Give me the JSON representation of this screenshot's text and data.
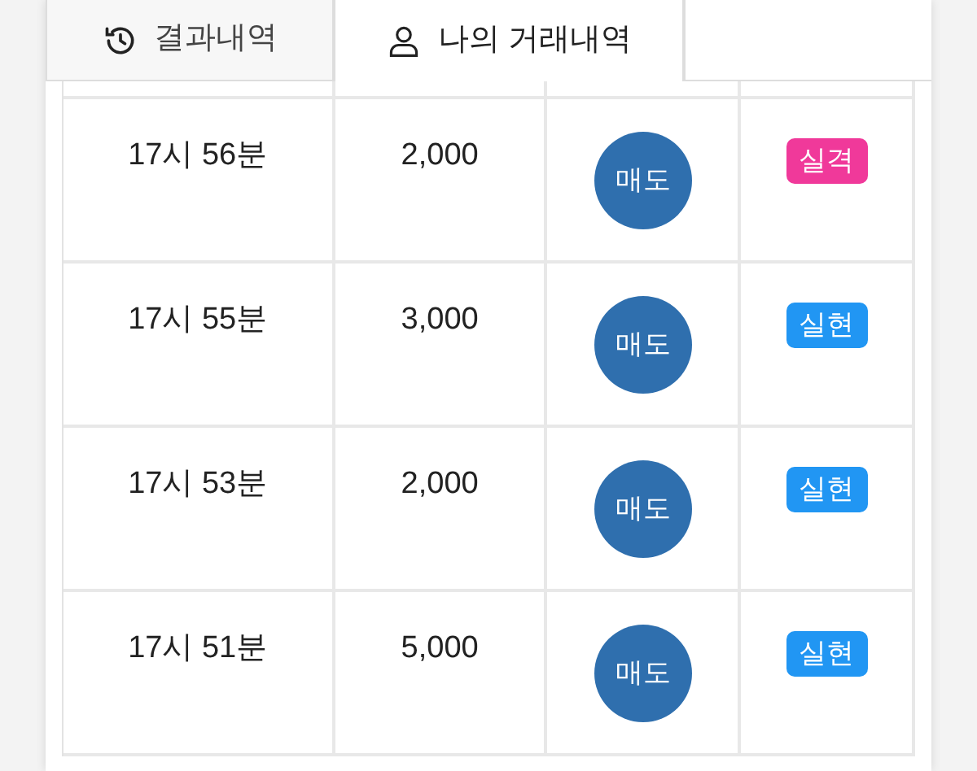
{
  "tabs": [
    {
      "label": "결과내역",
      "kind": "history",
      "selected": false
    },
    {
      "label": "나의 거래내역",
      "kind": "person",
      "selected": true
    }
  ],
  "rows": [
    {
      "time": "17시 56분",
      "amount": "2,000",
      "action": "매도",
      "result": "실격",
      "color": "#f0399a"
    },
    {
      "time": "17시 55분",
      "amount": "3,000",
      "action": "매도",
      "result": "실현",
      "color": "#2196f3"
    },
    {
      "time": "17시 53분",
      "amount": "2,000",
      "action": "매도",
      "result": "실현",
      "color": "#2196f3"
    },
    {
      "time": "17시 51분",
      "amount": "5,000",
      "action": "매도",
      "result": "실현",
      "color": "#2196f3"
    }
  ]
}
